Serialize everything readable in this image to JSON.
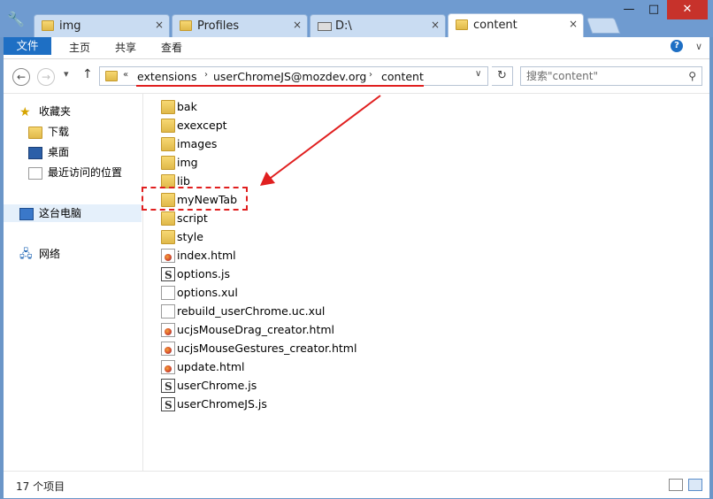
{
  "tabs": [
    {
      "label": "img",
      "close": "×"
    },
    {
      "label": "Profiles",
      "close": "×"
    },
    {
      "label": "D:\\",
      "close": "×"
    },
    {
      "label": "content",
      "close": "×"
    }
  ],
  "window": {
    "minimize": "—",
    "maximize": "□",
    "close": "✕"
  },
  "ribbon": {
    "file": "文件",
    "home": "主页",
    "share": "共享",
    "view": "查看",
    "expand": "∨",
    "help": "?"
  },
  "nav": {
    "back": "←",
    "forward": "→",
    "recent": "▾",
    "up": "↑"
  },
  "address": {
    "overflow": "«",
    "crumbs": [
      "extensions",
      "userChromeJS@mozdev.org",
      "content"
    ],
    "sep": "›",
    "dropdown": "∨",
    "refresh": "↻"
  },
  "search": {
    "placeholder": "搜索\"content\"",
    "icon": "⚲"
  },
  "sidebar": {
    "favorites": "收藏夹",
    "downloads": "下载",
    "desktop": "桌面",
    "recent": "最近访问的位置",
    "thispc": "这台电脑",
    "network": "网络"
  },
  "files": [
    {
      "name": "bak",
      "type": "folder"
    },
    {
      "name": "exexcept",
      "type": "folder"
    },
    {
      "name": "images",
      "type": "folder"
    },
    {
      "name": "img",
      "type": "folder"
    },
    {
      "name": "lib",
      "type": "folder"
    },
    {
      "name": "myNewTab",
      "type": "folder"
    },
    {
      "name": "script",
      "type": "folder"
    },
    {
      "name": "style",
      "type": "folder"
    },
    {
      "name": "index.html",
      "type": "html"
    },
    {
      "name": "options.js",
      "type": "js"
    },
    {
      "name": "options.xul",
      "type": "doc"
    },
    {
      "name": "rebuild_userChrome.uc.xul",
      "type": "doc"
    },
    {
      "name": "ucjsMouseDrag_creator.html",
      "type": "html"
    },
    {
      "name": "ucjsMouseGestures_creator.html",
      "type": "html"
    },
    {
      "name": "update.html",
      "type": "html"
    },
    {
      "name": "userChrome.js",
      "type": "js"
    },
    {
      "name": "userChromeJS.js",
      "type": "js"
    }
  ],
  "status": {
    "count": "17 个项目"
  },
  "colors": {
    "accent": "#1e6fc4",
    "annotation": "#e01f1f",
    "titlebar": "#6f9bd0"
  }
}
